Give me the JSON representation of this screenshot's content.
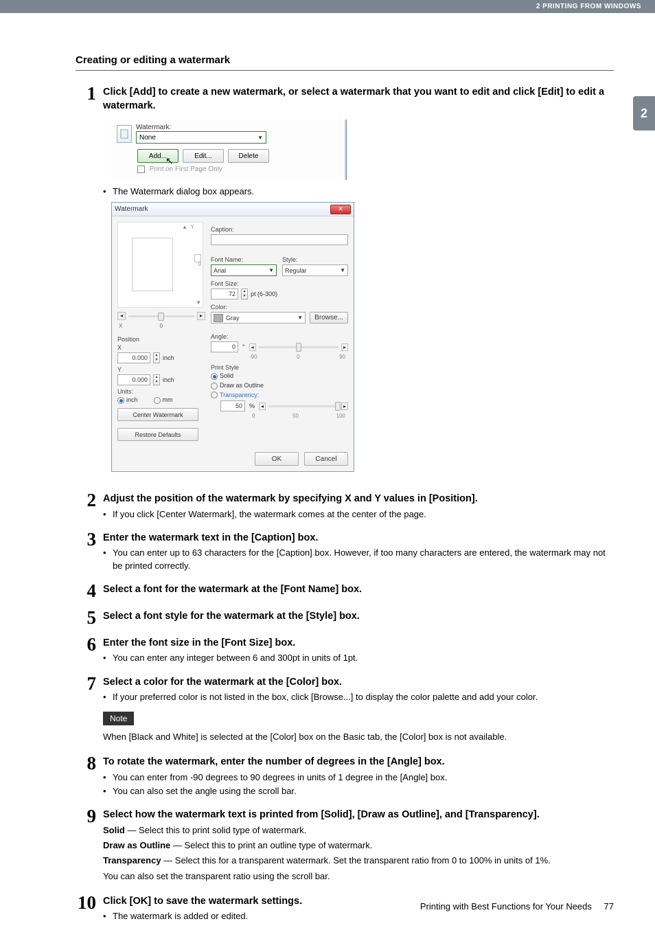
{
  "header": {
    "breadcrumb": "2 PRINTING FROM WINDOWS"
  },
  "tab": {
    "number": "2"
  },
  "section": {
    "title": "Creating or editing a watermark"
  },
  "steps": {
    "s1": {
      "num": "1",
      "heading": "Click [Add] to create a new watermark, or select a watermark that you want to edit and click [Edit] to edit a watermark.",
      "after_shot": "The Watermark dialog box appears."
    },
    "s2": {
      "num": "2",
      "heading": "Adjust the position of the watermark by specifying X and Y values in [Position].",
      "b1": "If you click [Center Watermark], the watermark comes at the center of the page."
    },
    "s3": {
      "num": "3",
      "heading": "Enter the watermark text in the [Caption] box.",
      "b1": "You can enter up to 63 characters for the [Caption] box.  However, if too many characters are entered, the watermark may not be printed correctly."
    },
    "s4": {
      "num": "4",
      "heading": "Select a font for the watermark at the [Font Name] box."
    },
    "s5": {
      "num": "5",
      "heading": "Select a font style for the watermark at the [Style] box."
    },
    "s6": {
      "num": "6",
      "heading": "Enter the font size in the [Font Size] box.",
      "b1": "You can enter any integer between 6 and 300pt in units of 1pt."
    },
    "s7": {
      "num": "7",
      "heading": "Select a color for the watermark at the [Color] box.",
      "b1": "If your preferred color is not listed in the box, click [Browse...] to display the color palette and add your color.",
      "note_label": "Note",
      "note_text": "When [Black and White] is selected at the [Color] box on the Basic tab, the [Color] box is not available."
    },
    "s8": {
      "num": "8",
      "heading": "To rotate the watermark, enter the number of degrees in the [Angle] box.",
      "b1": "You can enter from -90 degrees to 90 degrees in units of 1 degree in the [Angle] box.",
      "b2": "You can also set the angle using the scroll bar."
    },
    "s9": {
      "num": "9",
      "heading": "Select how the watermark text is printed from [Solid], [Draw as Outline], and [Transparency].",
      "l1a": "Solid",
      "l1b": " — Select this to print solid type of watermark.",
      "l2a": "Draw as Outline",
      "l2b": " — Select this to print an outline type of watermark.",
      "l3a": "Transparency",
      "l3b": " — Select this for a transparent watermark.  Set the transparent ratio from 0 to 100% in units of 1%.",
      "l4": "You can also set the transparent ratio using the scroll bar."
    },
    "s10": {
      "num": "10",
      "heading": "Click [OK] to save the watermark settings.",
      "b1": "The watermark is added or edited."
    }
  },
  "shot1": {
    "label": "Watermark:",
    "value": "None",
    "add": "Add...",
    "edit": "Edit...",
    "delete": "Delete",
    "firstpage": "Print on First Page Only"
  },
  "shot2": {
    "title": "Watermark",
    "axis_y": "Y",
    "axis_0": "0",
    "xy_x": "X",
    "xy_0": "0",
    "pos": "Position",
    "pos_x": "X",
    "pos_x_val": "0.000",
    "pos_y": "Y",
    "pos_y_val": "0.000",
    "unit_inch": "inch",
    "units": "Units:",
    "unit_mm": "mm",
    "center": "Center Watermark",
    "restore": "Restore Defaults",
    "caption": "Caption:",
    "fontname": "Font Name:",
    "fontname_val": "Arial",
    "style": "Style:",
    "style_val": "Regular",
    "fontsize": "Font Size:",
    "fontsize_val": "72",
    "fontsize_range": "pt (6-300)",
    "color": "Color:",
    "color_val": "Gray",
    "browse": "Browse...",
    "angle": "Angle:",
    "angle_val": "0",
    "angle_deg": "°",
    "angle_min": "-90",
    "angle_mid": "0",
    "angle_max": "90",
    "printstyle": "Print Style",
    "solid": "Solid",
    "outline": "Draw as Outline",
    "transparency": "Transparency:",
    "trans_val": "50",
    "trans_pct": "%",
    "trans_0": "0",
    "trans_50": "50",
    "trans_100": "100",
    "ok": "OK",
    "cancel": "Cancel"
  },
  "footer": {
    "text": "Printing with Best Functions for Your Needs",
    "page": "77"
  }
}
